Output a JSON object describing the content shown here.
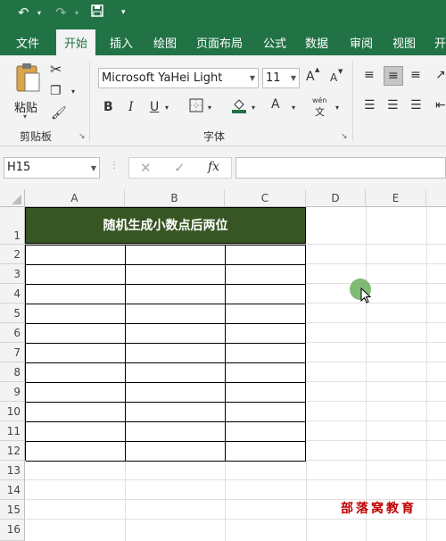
{
  "tabs": [
    "文件",
    "开始",
    "插入",
    "绘图",
    "页面布局",
    "公式",
    "数据",
    "审阅",
    "视图",
    "开"
  ],
  "clipboard": {
    "paste_label": "粘贴",
    "group_label": "剪贴板"
  },
  "font": {
    "name": "Microsoft YaHei Light",
    "size": "11",
    "bold": "B",
    "italic": "I",
    "underline": "U",
    "group_label": "字体",
    "increase": "A",
    "decrease": "A",
    "phonetic_top": "wén",
    "phonetic_bottom": "文"
  },
  "formula_bar": {
    "name_box": "H15",
    "fx": "fx",
    "value": ""
  },
  "columns": [
    "A",
    "B",
    "C",
    "D",
    "E"
  ],
  "rows": [
    "1",
    "2",
    "3",
    "4",
    "5",
    "6",
    "7",
    "8",
    "9",
    "10",
    "11",
    "12",
    "13",
    "14",
    "15",
    "16"
  ],
  "sheet": {
    "title": "随机生成小数点后两位"
  },
  "watermark": "部落窝教育",
  "colors": {
    "accent": "#217346",
    "title_fill": "#375623",
    "watermark": "#c00000",
    "cursor": "#6aaf5e"
  }
}
